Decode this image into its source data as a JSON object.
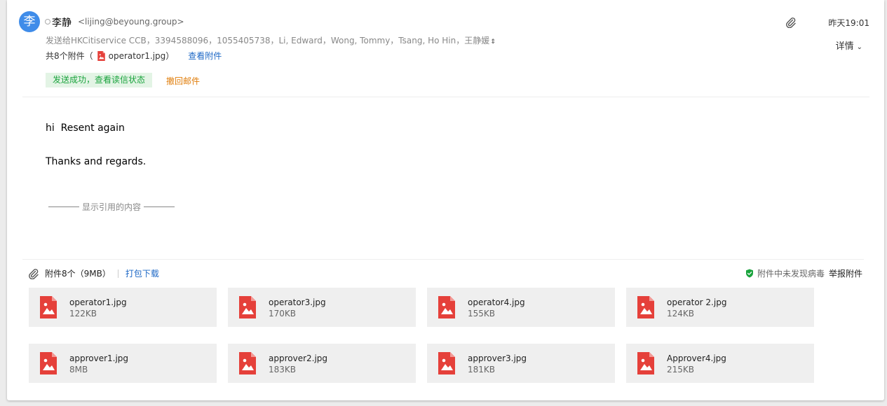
{
  "sender": {
    "avatar_char": "李",
    "name": "李静",
    "email": "<lijing@beyoung.group>"
  },
  "recipients_text": "发送给HKCitiservice CCB，3394588096，1055405738，Li, Edward，Wong, Tommy，Tsang, Ho Hin，王静媛",
  "recipients_caret": "⇕",
  "attach_summary": {
    "prefix": "共8个附件（",
    "first_file": "operator1.jpg",
    "suffix": "）",
    "view_link": "查看附件"
  },
  "status_badge": "发送成功，查看读信状态",
  "recall_link": "撤回邮件",
  "time": "昨天19:01",
  "details_label": "详情",
  "body": {
    "line1": "hi  Resent again",
    "line2": "Thanks and regards."
  },
  "quoted_label": "显示引用的内容",
  "attachments_header": {
    "label": "附件8个（9MB）",
    "pack_download": "打包下载",
    "virus_ok": "附件中未发现病毒",
    "report": "举报附件"
  },
  "colors": {
    "accent": "#1e68c6",
    "avatar": "#3f8ce9",
    "file_icon": "#e5403a",
    "success_bg": "#e3f4e5",
    "success_text": "#1aa33d",
    "recall": "#e07d0a",
    "shield": "#1aa33d"
  },
  "attachments": [
    {
      "name": "operator1.jpg",
      "size": "122KB"
    },
    {
      "name": "operator3.jpg",
      "size": "170KB"
    },
    {
      "name": "operator4.jpg",
      "size": "155KB"
    },
    {
      "name": "operator 2.jpg",
      "size": "124KB"
    },
    {
      "name": "approver1.jpg",
      "size": "8MB"
    },
    {
      "name": "approver2.jpg",
      "size": "183KB"
    },
    {
      "name": "approver3.jpg",
      "size": "181KB"
    },
    {
      "name": "Approver4.jpg",
      "size": "215KB"
    }
  ]
}
